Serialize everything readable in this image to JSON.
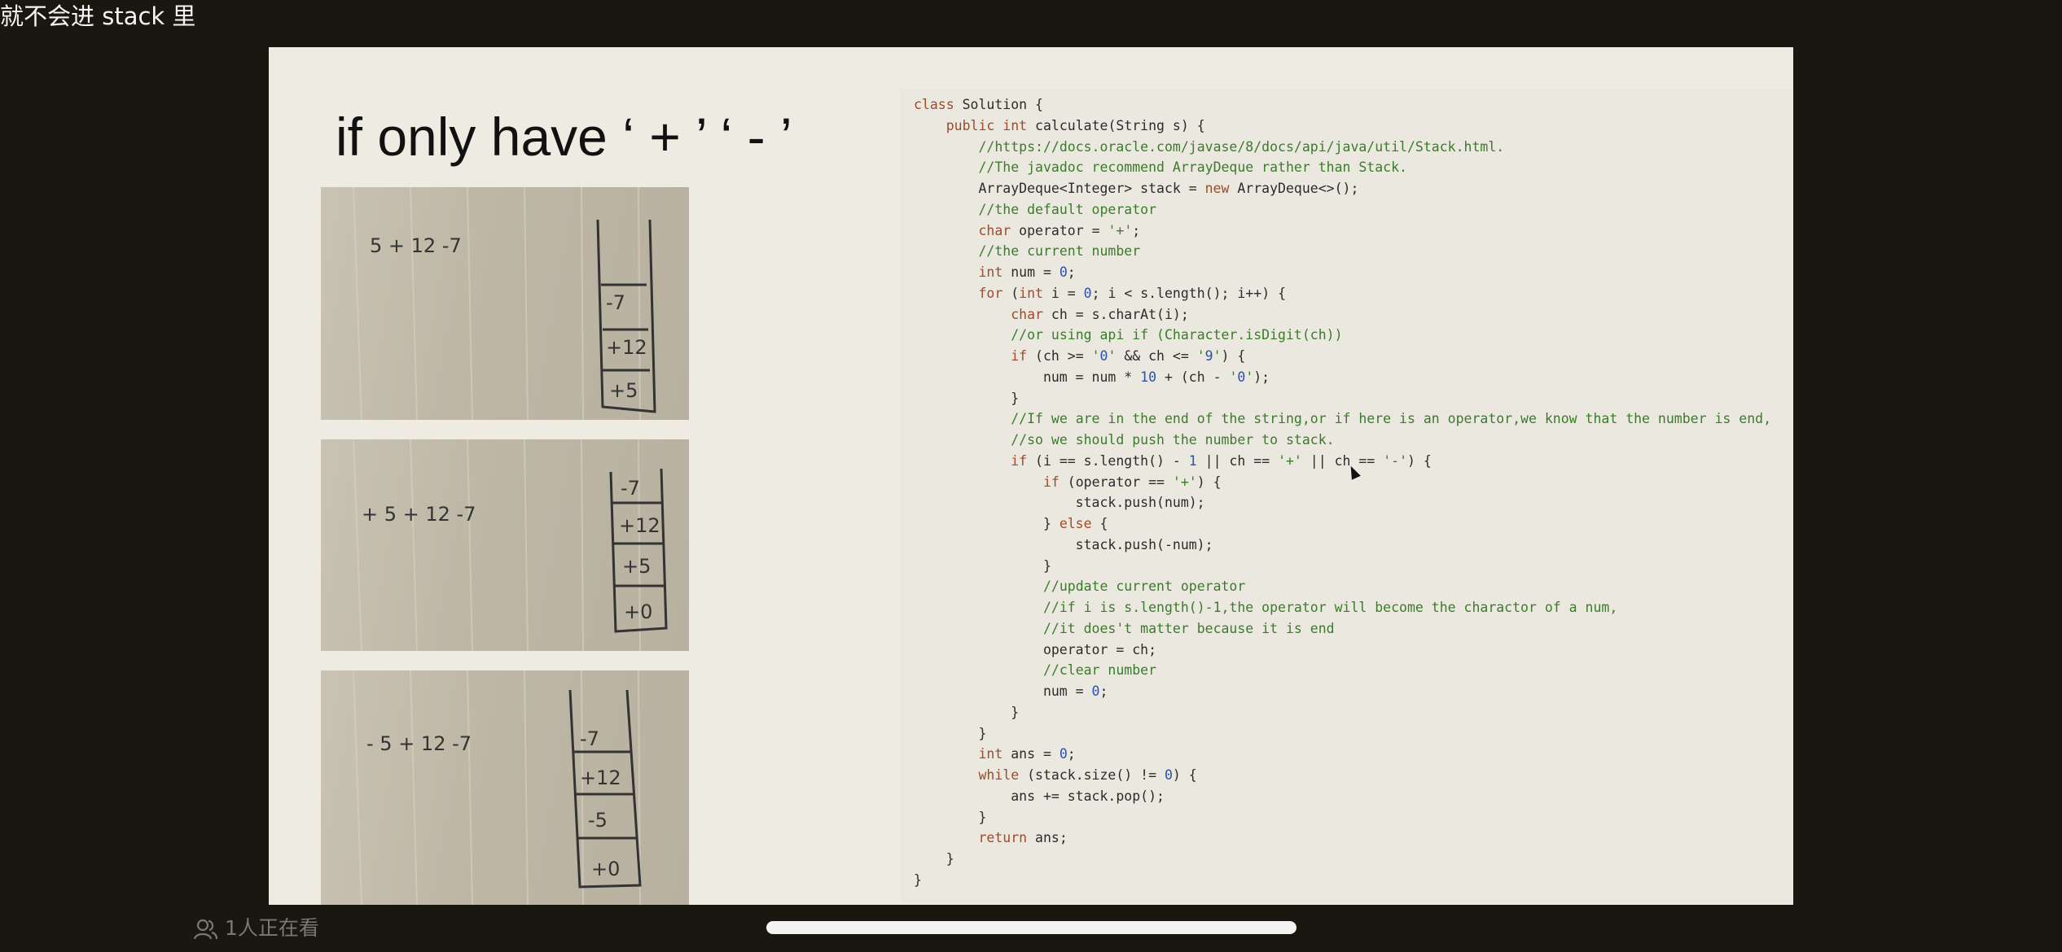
{
  "caption": "就不会进 stack 里",
  "slide": {
    "title": "if only have ‘ + ’ ‘ - ’",
    "photos": [
      {
        "expression": "5 + 12 -7",
        "stack": [
          "-7",
          "+12",
          "+5"
        ]
      },
      {
        "expression": "+ 5 + 12 -7",
        "stack": [
          "-7",
          "+12",
          "+5",
          "+0"
        ]
      },
      {
        "expression": "- 5 + 12 -7",
        "stack": [
          "-7",
          "+12",
          "-5",
          "+0"
        ]
      }
    ],
    "code": [
      "class Solution {",
      "    public int calculate(String s) {",
      "        //https://docs.oracle.com/javase/8/docs/api/java/util/Stack.html.",
      "        //The javadoc recommend ArrayDeque rather than Stack.",
      "        ArrayDeque<Integer> stack = new ArrayDeque<>();",
      "        //the default operator",
      "        char operator = '+';",
      "        //the current number",
      "        int num = 0;",
      "        for (int i = 0; i < s.length(); i++) {",
      "            char ch = s.charAt(i);",
      "            //or using api if (Character.isDigit(ch))",
      "            if (ch >= '0' && ch <= '9') {",
      "                num = num * 10 + (ch - '0');",
      "            }",
      "            //If we are in the end of the string,or if here is an operator,we know that the number is end,",
      "            //so we should push the number to stack.",
      "            if (i == s.length() - 1 || ch == '+' || ch == '-') {",
      "                if (operator == '+') {",
      "                    stack.push(num);",
      "                } else {",
      "                    stack.push(-num);",
      "                }",
      "                //update current operator",
      "                //if i is s.length()-1,the operator will become the charactor of a num,",
      "                //it does't matter because it is end",
      "                operator = ch;",
      "                //clear number",
      "                num = 0;",
      "            }",
      "        }",
      "        int ans = 0;",
      "        while (stack.size() != 0) {",
      "            ans += stack.pop();",
      "        }",
      "        return ans;",
      "    }",
      "}"
    ]
  },
  "footer": {
    "viewer_count": "1人正在看",
    "viewer_icon": "people-icon"
  },
  "colors": {
    "background": "#1a1710",
    "slide": "#eeece2",
    "keyword": "#a04a2a",
    "comment": "#3c7a2c",
    "number": "#2a50b0"
  }
}
